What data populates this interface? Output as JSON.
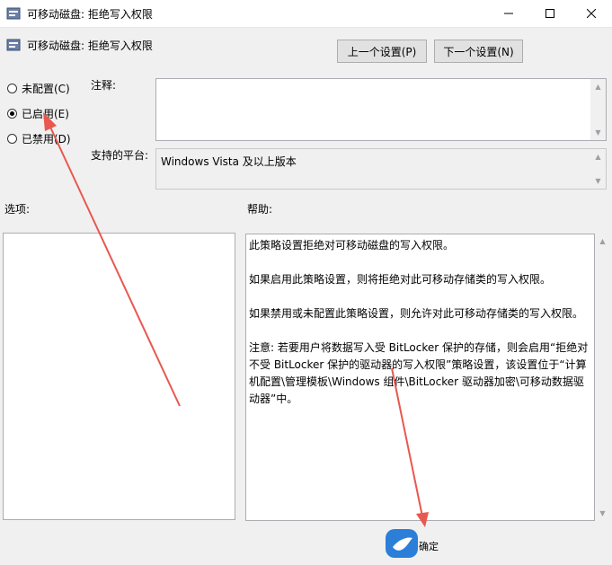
{
  "window": {
    "title": "可移动磁盘: 拒绝写入权限",
    "minimize_icon": "minimize-icon",
    "maximize_icon": "maximize-icon",
    "close_icon": "close-icon"
  },
  "header": {
    "policy_title": "可移动磁盘: 拒绝写入权限",
    "prev_button": "上一个设置(P)",
    "next_button": "下一个设置(N)"
  },
  "radios": [
    {
      "label": "未配置(C)",
      "checked": false
    },
    {
      "label": "已启用(E)",
      "checked": true
    },
    {
      "label": "已禁用(D)",
      "checked": false
    }
  ],
  "comment": {
    "label": "注释:",
    "value": ""
  },
  "platform": {
    "label": "支持的平台:",
    "value": "Windows Vista 及以上版本"
  },
  "options": {
    "label": "选项:"
  },
  "help": {
    "label": "帮助:",
    "paragraphs": [
      "此策略设置拒绝对可移动磁盘的写入权限。",
      "如果启用此策略设置，则将拒绝对此可移动存储类的写入权限。",
      "如果禁用或未配置此策略设置，则允许对此可移动存储类的写入权限。",
      "注意: 若要用户将数据写入受 BitLocker 保护的存储，则会启用“拒绝对不受 BitLocker 保护的驱动器的写入权限”策略设置，该设置位于“计算机配置\\管理模板\\Windows 组件\\BitLocker 驱动器加密\\可移动数据驱动器”中。"
    ]
  },
  "footer": {
    "ok_label": "确定"
  },
  "colors": {
    "annotation_arrow": "#e8584f",
    "watermark_blue": "#2c7fd8"
  }
}
